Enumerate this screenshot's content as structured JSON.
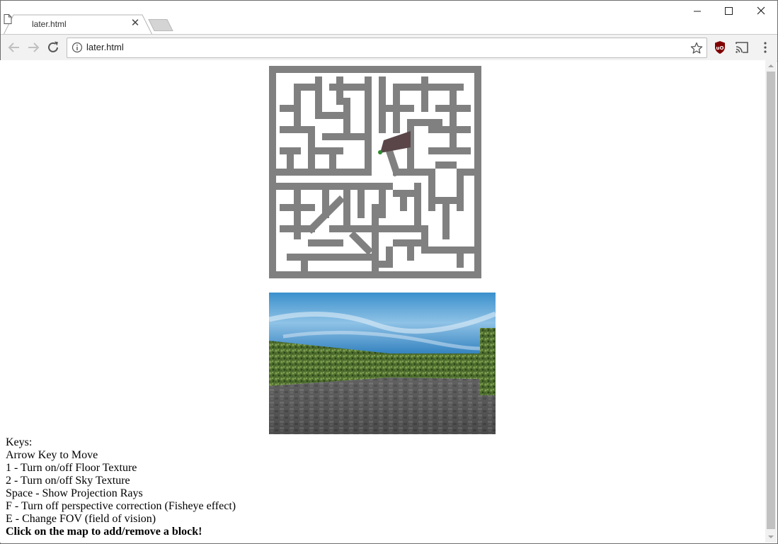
{
  "browser": {
    "tab": {
      "title": "later.html"
    },
    "address": "later.html"
  },
  "icons": {
    "tab": "file-icon",
    "close": "close-icon",
    "back": "back-arrow-icon",
    "forward": "forward-arrow-icon",
    "reload": "reload-icon",
    "info": "info-icon",
    "bookmark": "star-icon",
    "extension": "ublock-origin-icon",
    "cast": "cast-icon",
    "menu": "kebab-menu-icon",
    "minimize": "minimize-icon",
    "maximize": "maximize-icon"
  },
  "colors": {
    "maze_wall": "#808080",
    "maze_floor": "#ffffff",
    "view_cone": "#5a4649",
    "player": "#2e8b2e",
    "sky": "#2d86c4",
    "hedge": "#4a6b2a",
    "floor": "#5a5a5a"
  },
  "help": {
    "lines": [
      "Keys:",
      "Arrow Key to Move",
      "1 - Turn on/off Floor Texture",
      "2 - Turn on/off Sky Texture",
      "Space - Show Projection Rays",
      "F - Turn off perspective correction (Fisheye effect)",
      "E - Change FOV (field of vision)"
    ],
    "emphasis": "Click on the map to add/remove a block!"
  }
}
